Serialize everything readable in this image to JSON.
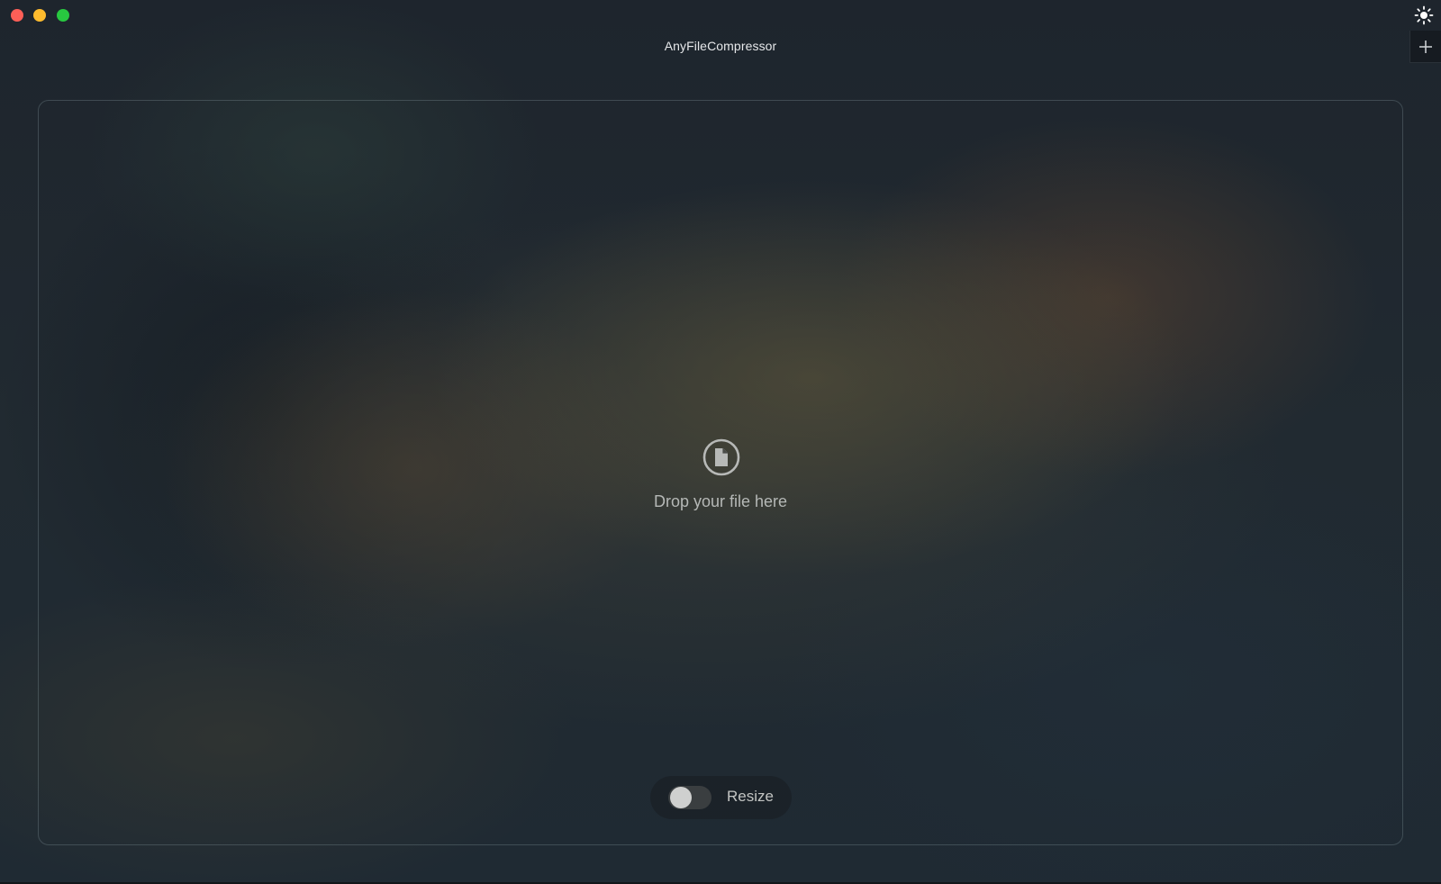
{
  "window": {
    "title": "AnyFileCompressor",
    "traffic_lights": {
      "close_color": "#fe5f57",
      "minimize_color": "#febc2e",
      "maximize_color": "#28c840"
    }
  },
  "toolbar": {
    "theme_toggle_icon": "sun-icon",
    "add_icon": "plus-icon"
  },
  "drop_zone": {
    "icon": "file-icon",
    "prompt": "Drop your file here"
  },
  "resize": {
    "label": "Resize",
    "enabled": false
  },
  "colors": {
    "text": "#e6e8ea",
    "muted_text": "#b5b8b6"
  }
}
